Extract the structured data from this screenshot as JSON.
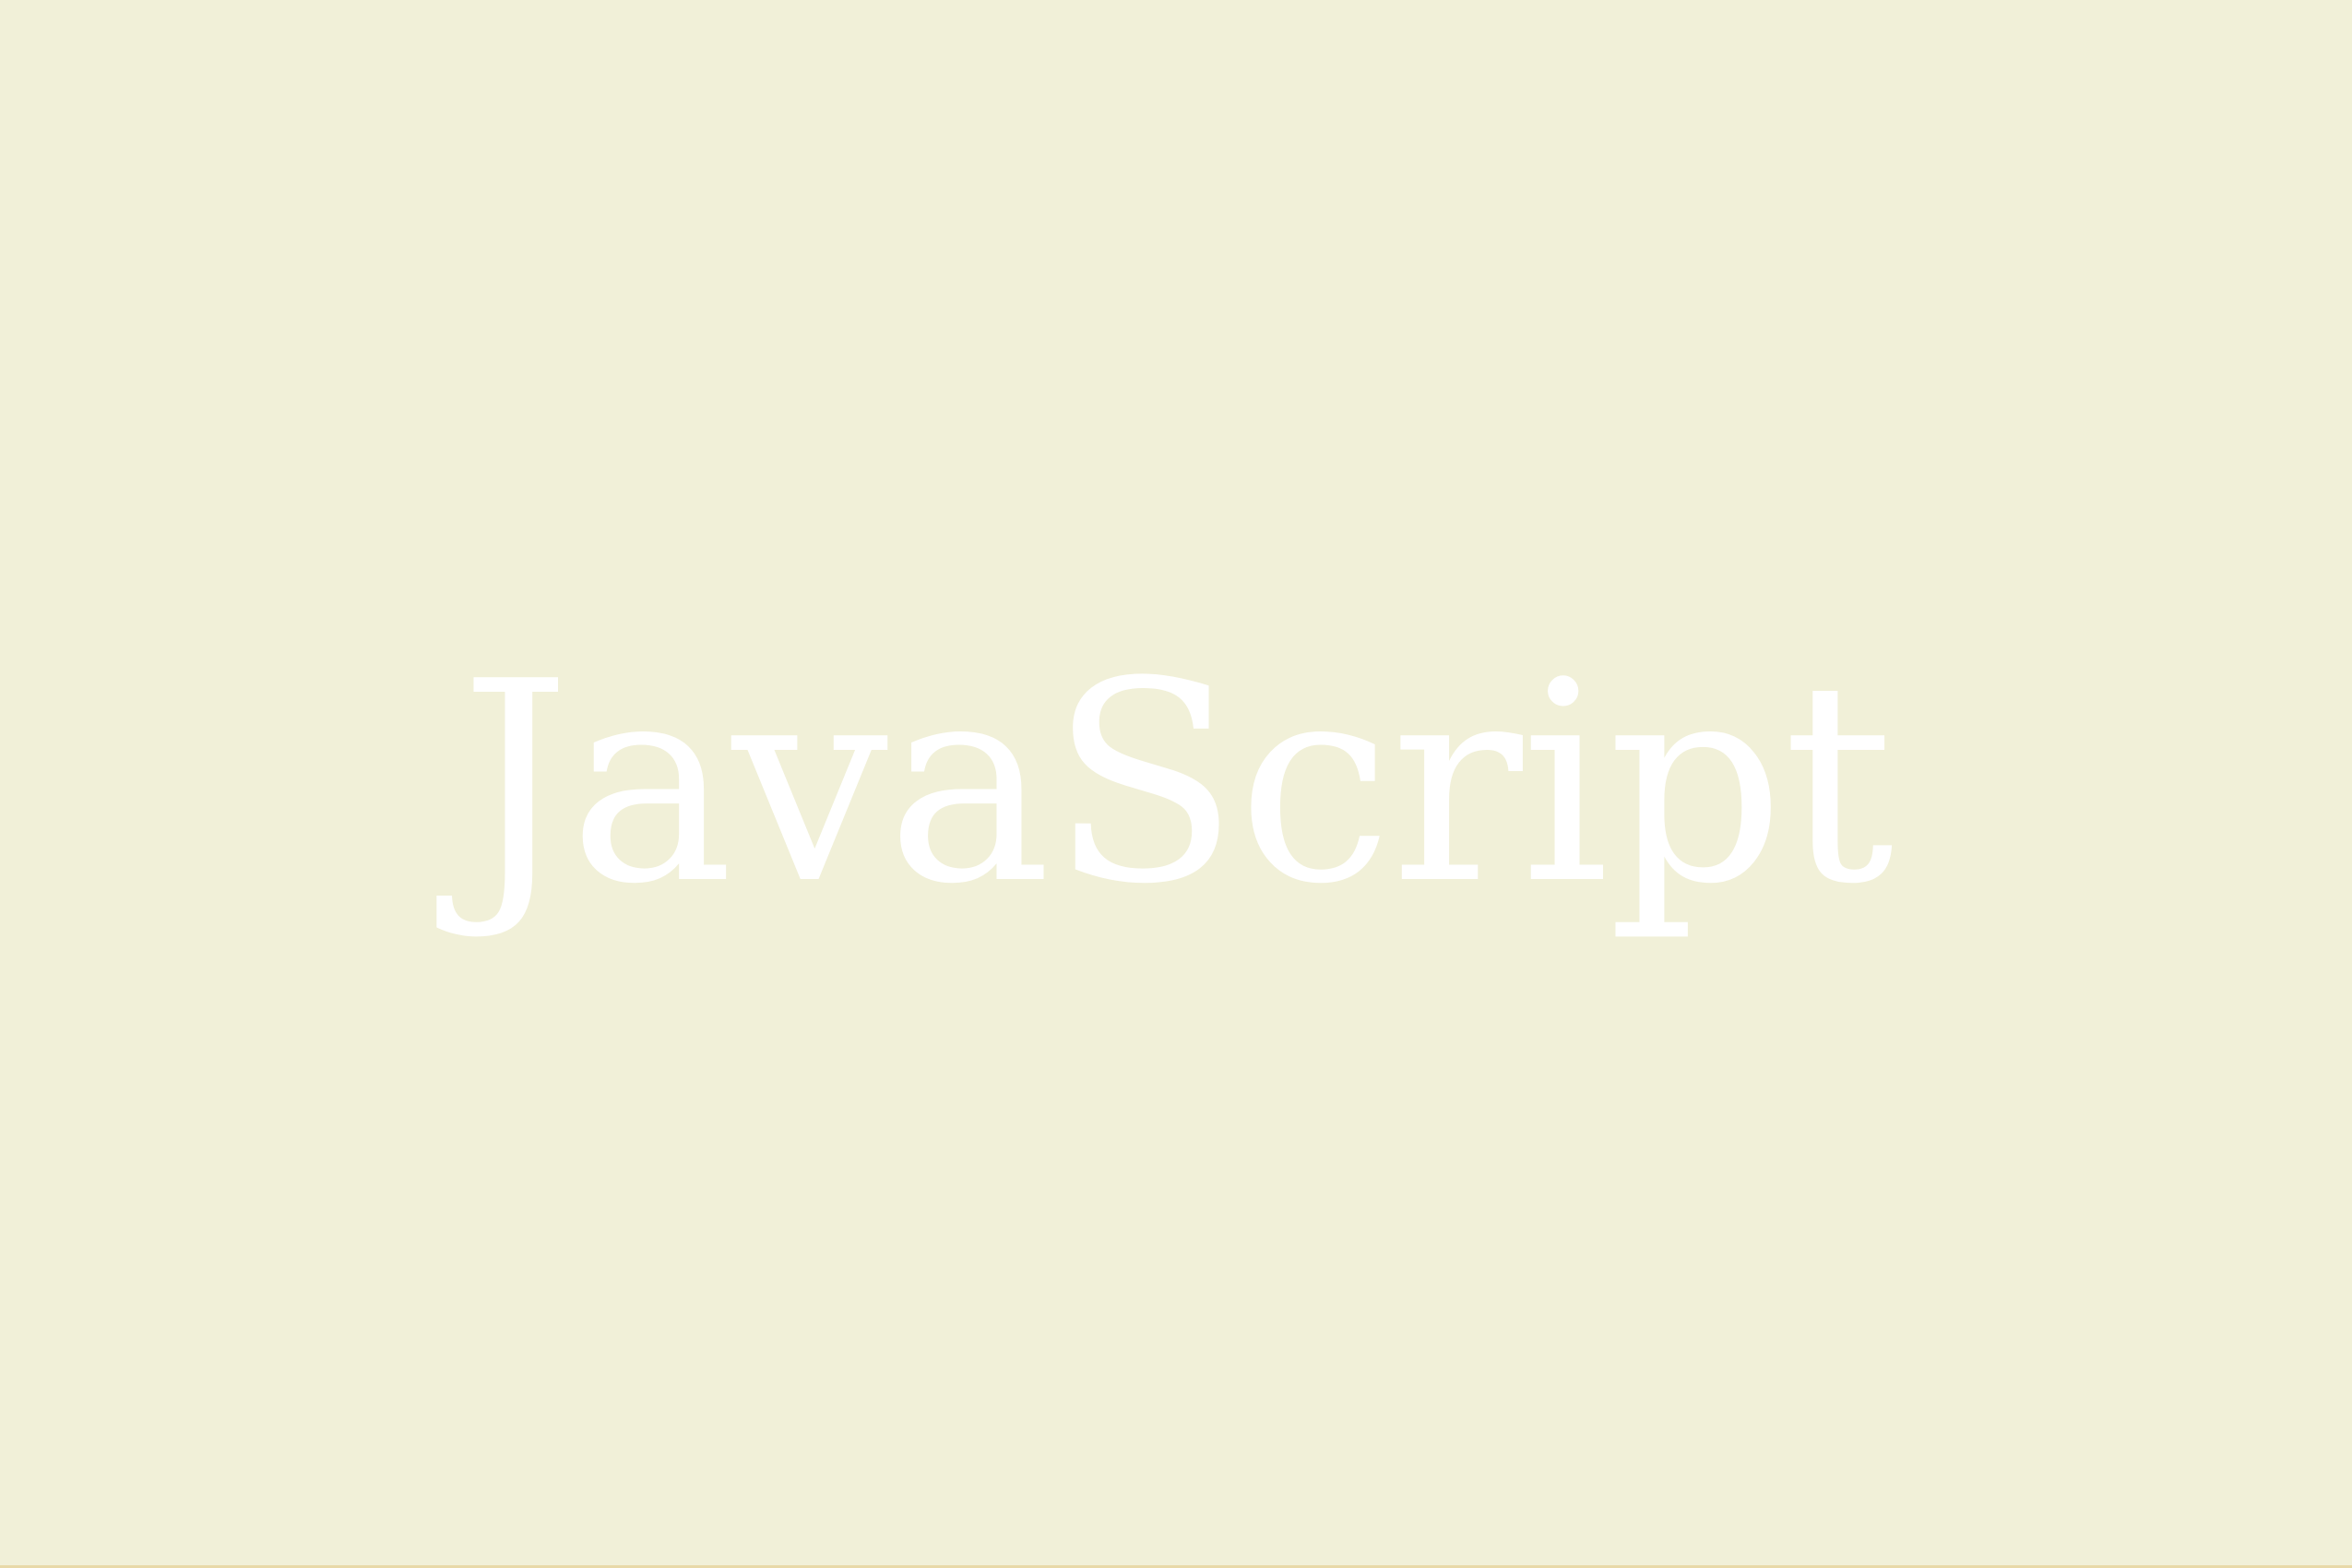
{
  "page": {
    "title": "JavaScript",
    "background_color": "#f1f0d8",
    "text_color": "#ffffff"
  }
}
